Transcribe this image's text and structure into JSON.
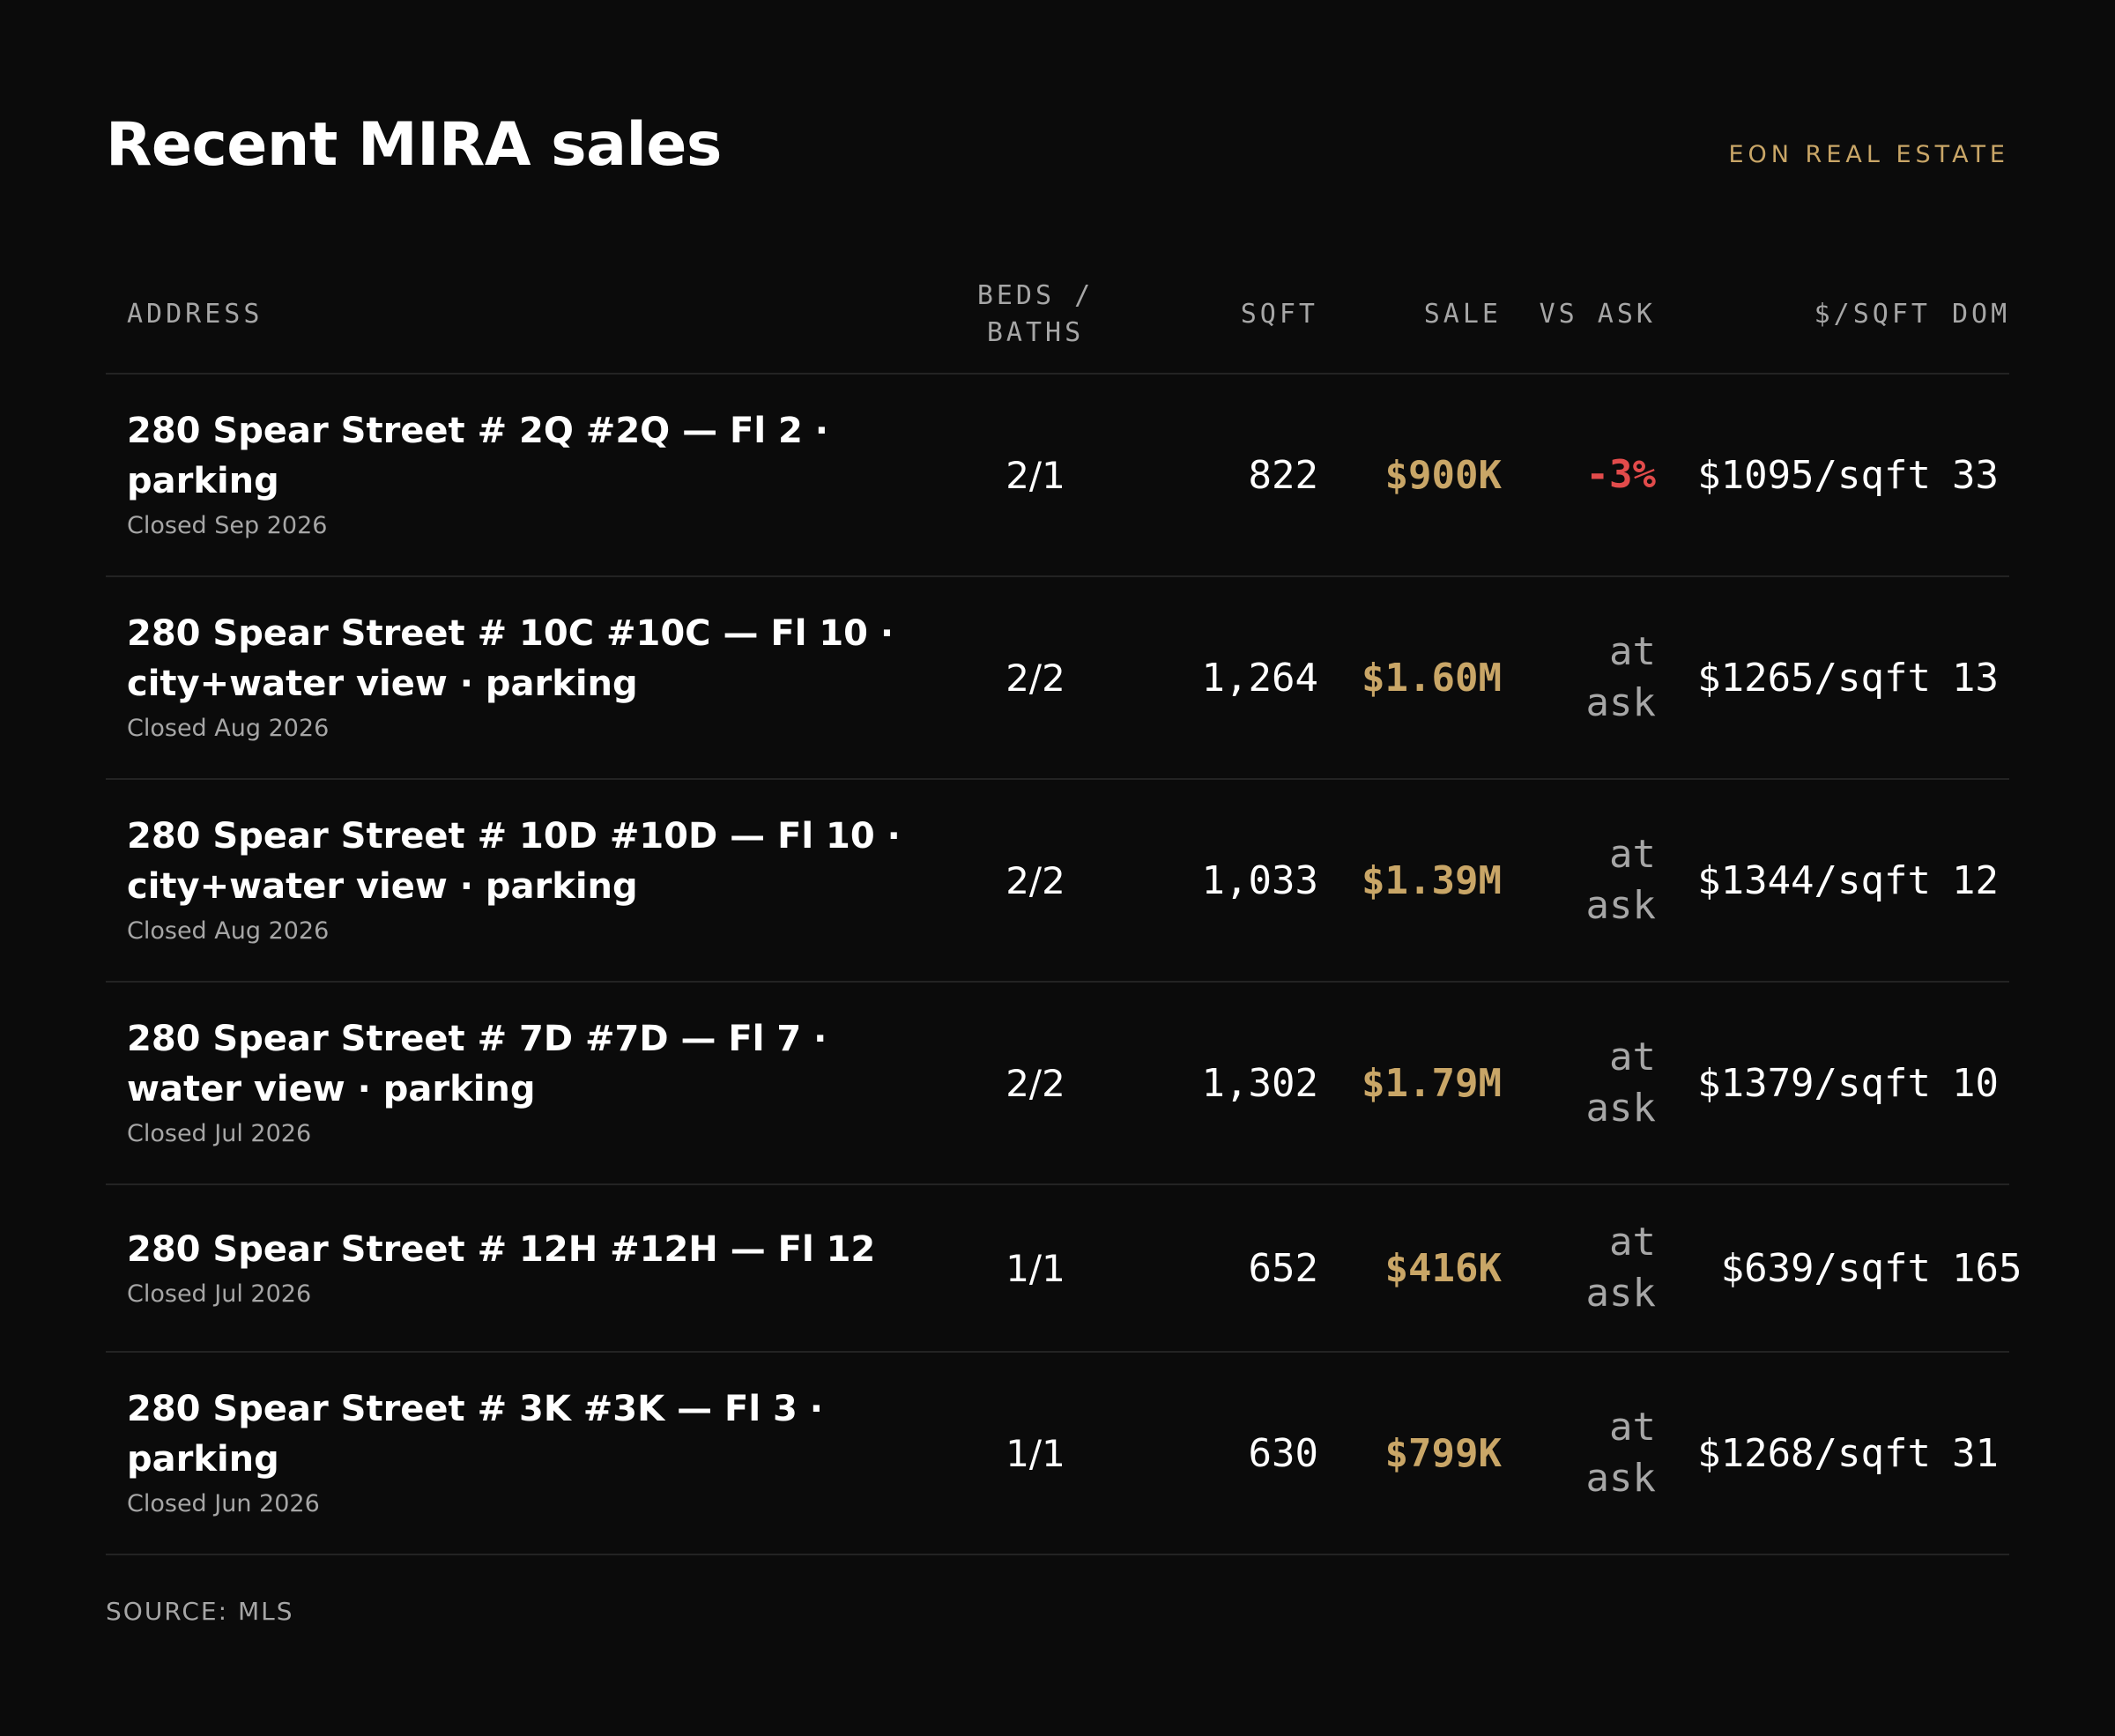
{
  "title": "Recent MIRA sales",
  "brand": "EON REAL ESTATE",
  "columns": {
    "address": "ADDRESS",
    "beds_baths": "BEDS / BATHS",
    "sqft": "SQFT",
    "sale": "SALE",
    "vs_ask": "VS ASK",
    "price_per_sqft": "$/SQFT",
    "dom": "DOM"
  },
  "rows": [
    {
      "address": "280 Spear Street # 2Q #2Q — Fl 2 · parking",
      "closed": "Closed Sep 2026",
      "beds_baths": "2/1",
      "sqft": "822",
      "sale": "$900K",
      "vs_ask": "-3%",
      "price_per_sqft": "$1095/sqft",
      "dom": "33"
    },
    {
      "address": "280 Spear Street # 10C #10C — Fl 10 · city+water view · parking",
      "closed": "Closed Aug 2026",
      "beds_baths": "2/2",
      "sqft": "1,264",
      "sale": "$1.60M",
      "vs_ask": "at ask",
      "price_per_sqft": "$1265/sqft",
      "dom": "13"
    },
    {
      "address": "280 Spear Street # 10D #10D — Fl 10 · city+water view · parking",
      "closed": "Closed Aug 2026",
      "beds_baths": "2/2",
      "sqft": "1,033",
      "sale": "$1.39M",
      "vs_ask": "at ask",
      "price_per_sqft": "$1344/sqft",
      "dom": "12"
    },
    {
      "address": "280 Spear Street # 7D #7D — Fl 7 · water view · parking",
      "closed": "Closed Jul 2026",
      "beds_baths": "2/2",
      "sqft": "1,302",
      "sale": "$1.79M",
      "vs_ask": "at ask",
      "price_per_sqft": "$1379/sqft",
      "dom": "10"
    },
    {
      "address": "280 Spear Street # 12H #12H — Fl 12",
      "closed": "Closed Jul 2026",
      "beds_baths": "1/1",
      "sqft": "652",
      "sale": "$416K",
      "vs_ask": "at ask",
      "price_per_sqft": "$639/sqft",
      "dom": "165"
    },
    {
      "address": "280 Spear Street # 3K #3K — Fl 3 · parking",
      "closed": "Closed Jun 2026",
      "beds_baths": "1/1",
      "sqft": "630",
      "sale": "$799K",
      "vs_ask": "at ask",
      "price_per_sqft": "$1268/sqft",
      "dom": "31"
    }
  ],
  "source": "SOURCE: MLS",
  "colors": {
    "background": "#0b0b0b",
    "accent_gold": "#c9a667",
    "negative_red": "#e24b4b",
    "muted_text": "#a6a6a6",
    "divider": "#232323"
  }
}
